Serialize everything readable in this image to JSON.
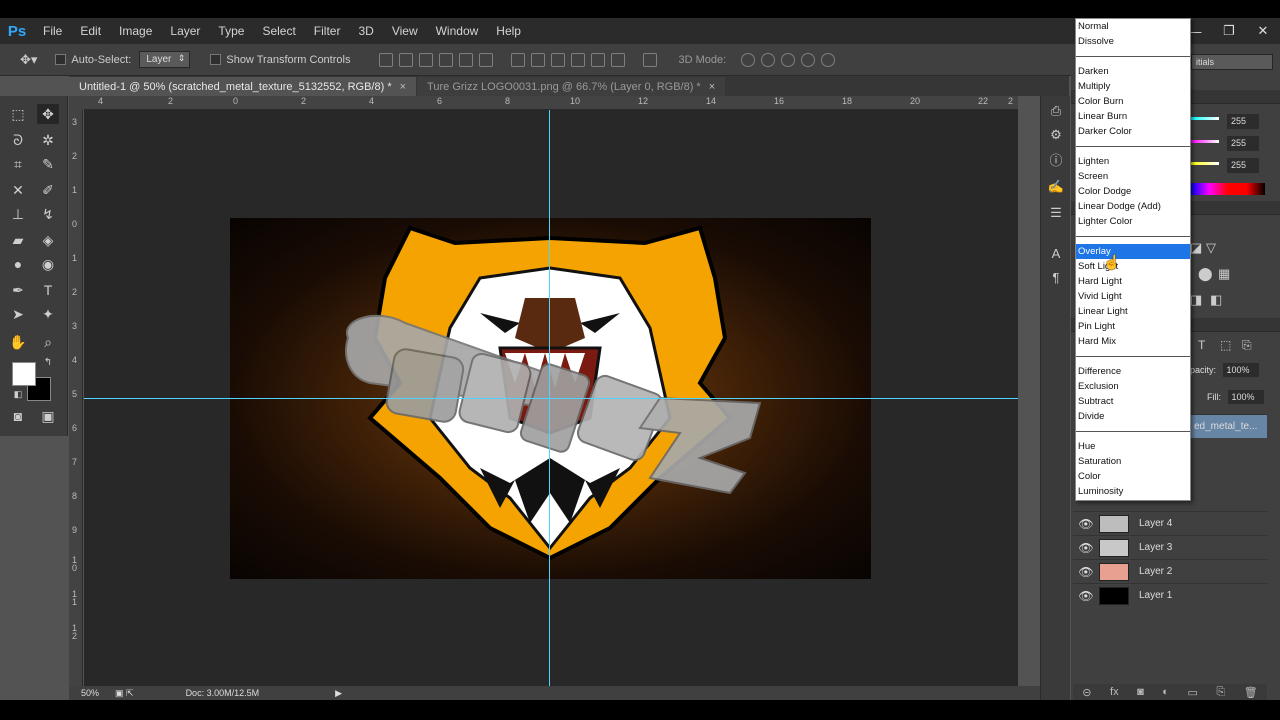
{
  "menubar": {
    "logo": "Ps",
    "items": [
      "File",
      "Edit",
      "Image",
      "Layer",
      "Type",
      "Select",
      "Filter",
      "3D",
      "View",
      "Window",
      "Help"
    ]
  },
  "window_controls": {
    "minimize": "—",
    "restore": "❐",
    "close": "✕"
  },
  "options": {
    "auto_select": "Auto-Select:",
    "auto_select_value": "Layer",
    "show_transform": "Show Transform Controls",
    "three_d_mode": "3D Mode:"
  },
  "tabs": [
    {
      "label": "Untitled-1 @ 50% (scratched_metal_texture_5132552, RGB/8) *",
      "close": "×"
    },
    {
      "label": "Ture Grizz LOGO0031.png @ 66.7% (Layer 0, RGB/8) *",
      "close": "×"
    }
  ],
  "ruler_top": [
    "4",
    "2",
    "0",
    "2",
    "4",
    "6",
    "8",
    "10",
    "12",
    "14",
    "16",
    "18",
    "20",
    "22",
    "2"
  ],
  "ruler_left": [
    "3",
    "2",
    "1",
    "0",
    "1",
    "2",
    "3",
    "4",
    "5",
    "6",
    "7",
    "8",
    "9",
    "1 0",
    "1 1",
    "1 2"
  ],
  "statusbar": {
    "zoom": "50%",
    "doc": "Doc: 3.00M/12.5M"
  },
  "workspace": "itials",
  "color_values": [
    "255",
    "255",
    "255"
  ],
  "layers_panel": {
    "opacity_label": "pacity:",
    "opacity_value": "100%",
    "fill_label": "Fill:",
    "fill_value": "100%",
    "selected_layer": "ed_metal_te...",
    "rows": [
      {
        "name": "Layer 4",
        "thumb": "#bdbdbd"
      },
      {
        "name": "Layer 3",
        "thumb": "#c8c8c8"
      },
      {
        "name": "Layer 2",
        "thumb": "#e8a090"
      },
      {
        "name": "Layer 1",
        "thumb": "#000000"
      }
    ]
  },
  "blend_menu": [
    {
      "label": "Normal"
    },
    {
      "label": "Dissolve"
    },
    {
      "sep": true
    },
    {
      "label": "Darken"
    },
    {
      "label": "Multiply"
    },
    {
      "label": "Color Burn"
    },
    {
      "label": "Linear Burn"
    },
    {
      "label": "Darker Color"
    },
    {
      "sep": true
    },
    {
      "label": "Lighten"
    },
    {
      "label": "Screen"
    },
    {
      "label": "Color Dodge"
    },
    {
      "label": "Linear Dodge (Add)"
    },
    {
      "label": "Lighter Color"
    },
    {
      "sep": true
    },
    {
      "label": "Overlay",
      "highlight": true
    },
    {
      "label": "Soft Light"
    },
    {
      "label": "Hard Light"
    },
    {
      "label": "Vivid Light"
    },
    {
      "label": "Linear Light"
    },
    {
      "label": "Pin Light"
    },
    {
      "label": "Hard Mix"
    },
    {
      "sep": true
    },
    {
      "label": "Difference"
    },
    {
      "label": "Exclusion"
    },
    {
      "label": "Subtract"
    },
    {
      "label": "Divide"
    },
    {
      "sep": true
    },
    {
      "label": "Hue"
    },
    {
      "label": "Saturation"
    },
    {
      "label": "Color"
    },
    {
      "label": "Luminosity"
    }
  ],
  "colors": {
    "accent": "#1e75e6",
    "guide": "#4fd3ff",
    "logo_orange": "#f5a300",
    "ps_blue": "#31a8ff"
  }
}
